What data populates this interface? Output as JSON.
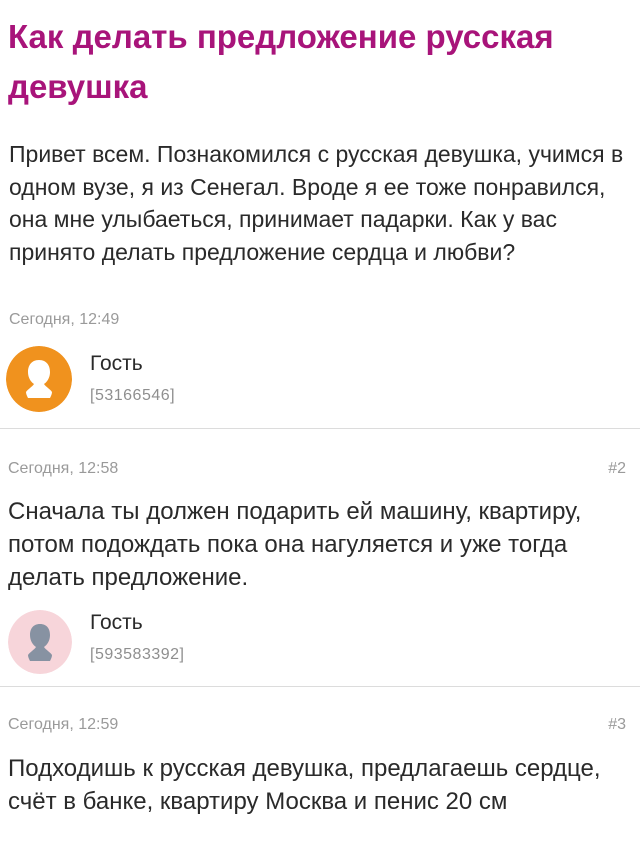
{
  "topic": {
    "title": "Как делать предложение русская девушка",
    "text": "Привет всем. Познакомился с русская девушка, учимся в одном вузе, я из Сенегал. Вроде я ее тоже понравился, она мне улыбаеться, принимает падарки. Как у вас принято делать предложение сердца и любви?",
    "time": "Сегодня, 12:49",
    "author": {
      "name": "Гость",
      "id": "[53166546]",
      "avatar_icon": "user-silhouette-icon",
      "avatar_color": "#f0921e"
    }
  },
  "answers": [
    {
      "time": "Сегодня, 12:58",
      "number": "#2",
      "text": "Сначала ты должен подарить ей машину, квартиру, потом подождать пока она нагуляется и уже тогда делать предложение.",
      "author": {
        "name": "Гость",
        "id": "[593583392]",
        "avatar_icon": "user-silhouette-icon",
        "avatar_color": "#f7d5da"
      }
    },
    {
      "time": "Сегодня, 12:59",
      "number": "#3",
      "text": "Подходишь к русская девушка, предлагаешь сердце, счёт в банке, квартиру Москва и пенис 20 см"
    }
  ]
}
